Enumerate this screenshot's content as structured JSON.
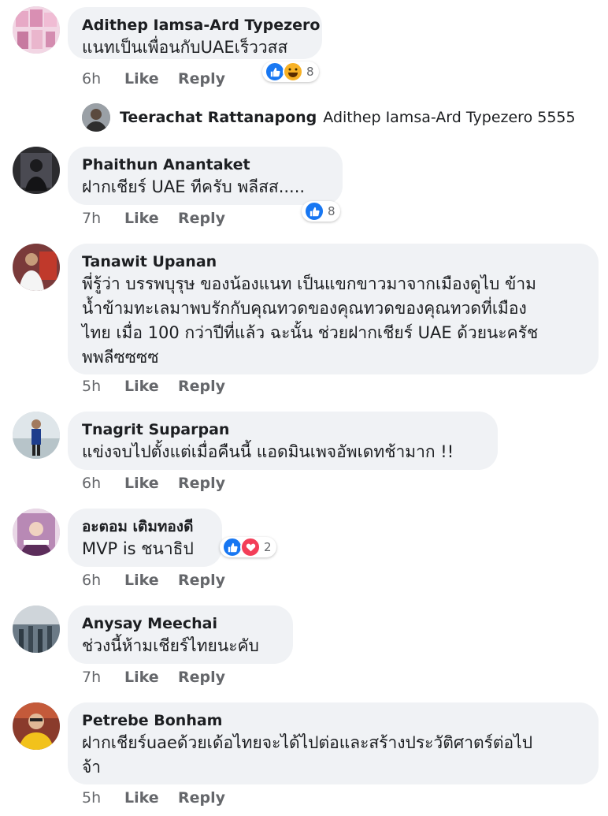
{
  "actions": {
    "like": "Like",
    "reply": "Reply"
  },
  "colors": {
    "like_blue": "#1877f2",
    "haha_yellow": "#f7b125",
    "love_red": "#f33e58",
    "bubble": "#f0f2f5"
  },
  "comments": [
    {
      "author": "Adithep Iamsa-Ard Typezero",
      "lines": [
        "แนทเป็นเพื่อนกับUAEเร็ววสส"
      ],
      "time": "6h",
      "reactions": [
        "like-icon",
        "haha-icon"
      ],
      "reaction_count": "8"
    },
    {
      "author": "Phaithun Anantaket",
      "lines": [
        "ฝากเชียร์ UAE ทีครับ พลีสส....."
      ],
      "time": "7h",
      "reactions": [
        "like-icon"
      ],
      "reaction_count": "8"
    },
    {
      "author": "Tanawit Upanan",
      "lines": [
        "พี่รู้ว่า บรรพบุรุษ ของน้องแนท เป็นแขกขาวมาจากเมืองดูไบ ข้าม",
        "น้ำข้ามทะเลมาพบรักกับคุณทวดของคุณทวดของคุณทวดที่เมือง",
        "ไทย เมื่อ 100 กว่าปีที่แล้ว ฉะนั้น ช่วยฝากเชียร์ UAE  ด้วยนะครัช",
        "พพลีซซซซ"
      ],
      "time": "5h"
    },
    {
      "author": "Tnagrit Suparpan",
      "lines": [
        "แข่งจบไปตั้งแต่เมื่อคืนนี้ แอดมินเพจอัพเดทช้ามาก !!"
      ],
      "time": "6h"
    },
    {
      "author": "อะตอม เติมทองดี",
      "lines": [
        "MVP is ชนาธิป"
      ],
      "time": "6h",
      "reactions": [
        "like-icon",
        "love-icon"
      ],
      "reaction_count": "2"
    },
    {
      "author": "Anysay Meechai",
      "lines": [
        "ช่วงนี้ห้ามเชียร์ไทยนะคับ"
      ],
      "time": "7h"
    },
    {
      "author": "Petrebe Bonham",
      "lines": [
        "ฝากเชียร์uaeด้วยเด้อไทยจะได้ไปต่อและสร้างประวัติศาตร์ต่อไป",
        "จ้า"
      ],
      "time": "5h"
    }
  ],
  "reply": {
    "author": "Teerachat Rattanapong",
    "text": "Adithep Iamsa-Ard Typezero 5555"
  }
}
